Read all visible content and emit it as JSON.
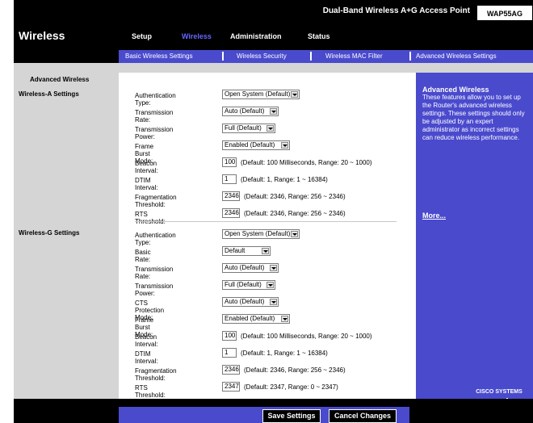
{
  "header": {
    "product_name": "Dual-Band Wireless A+G Access Point",
    "model": "WAP55AG",
    "section": "Wireless"
  },
  "nav": {
    "tabs": [
      "Setup",
      "Wireless",
      "Administration",
      "Status"
    ],
    "active": "Wireless",
    "subtabs": [
      "Basic Wireless Settings",
      "Wireless Security",
      "Wireless MAC Filter",
      "Advanced Wireless Settings"
    ]
  },
  "sidebar": {
    "heading": "Advanced Wireless",
    "wireless_a": "Wireless-A Settings",
    "wireless_g": "Wireless-G Settings"
  },
  "wireless_a": {
    "auth_label": "Authentication Type:",
    "auth_value": "Open System (Default)",
    "rate_label": "Transmission Rate:",
    "rate_value": "Auto (Default)",
    "power_label": "Transmission Power:",
    "power_value": "Full (Default)",
    "burst_label": "Frame Burst Mode:",
    "burst_value": "Enabled (Default)",
    "beacon_label": "Beacon Interval:",
    "beacon_value": "100",
    "beacon_hint": "(Default: 100 Milliseconds, Range: 20 ~ 1000)",
    "dtim_label": "DTIM Interval:",
    "dtim_value": "1",
    "dtim_hint": "(Default: 1, Range: 1 ~ 16384)",
    "frag_label": "Fragmentation Threshold:",
    "frag_value": "2346",
    "frag_hint": "(Default: 2346, Range: 256 ~ 2346)",
    "rts_label": "RTS Threshold:",
    "rts_value": "2346",
    "rts_hint": "(Default: 2346, Range: 256 ~ 2346)"
  },
  "wireless_g": {
    "auth_label": "Authentication Type:",
    "auth_value": "Open System (Default)",
    "basic_label": "Basic Rate:",
    "basic_value": "Default",
    "rate_label": "Transmission Rate:",
    "rate_value": "Auto (Default)",
    "power_label": "Transmission Power:",
    "power_value": "Full (Default)",
    "cts_label": "CTS Protection Mode:",
    "cts_value": "Auto (Default)",
    "burst_label": "Frame Burst Mode:",
    "burst_value": "Enabled (Default)",
    "beacon_label": "Beacon Interval:",
    "beacon_value": "100",
    "beacon_hint": "(Default: 100 Milliseconds, Range: 20 ~ 1000)",
    "dtim_label": "DTIM Interval:",
    "dtim_value": "1",
    "dtim_hint": "(Default: 1, Range: 1 ~ 16384)",
    "frag_label": "Fragmentation Threshold:",
    "frag_value": "2346",
    "frag_hint": "(Default: 2346, Range: 256 ~ 2346)",
    "rts_label": "RTS Threshold:",
    "rts_value": "2347",
    "rts_hint": "(Default: 2347, Range: 0 ~ 2347)"
  },
  "help": {
    "title": "Advanced Wireless",
    "text": "These features allow you to set up the Router's advanced wireless settings. These settings should only be adjusted by an expert administrator as incorrect settings can reduce wireless performance.",
    "more": "More..."
  },
  "footer": {
    "save": "Save Settings",
    "cancel": "Cancel Changes",
    "logo": "Cisco Systems"
  },
  "colors": {
    "accent": "#4a4acd",
    "active_tab": "#6666ff",
    "background": "#d5d5d5"
  }
}
